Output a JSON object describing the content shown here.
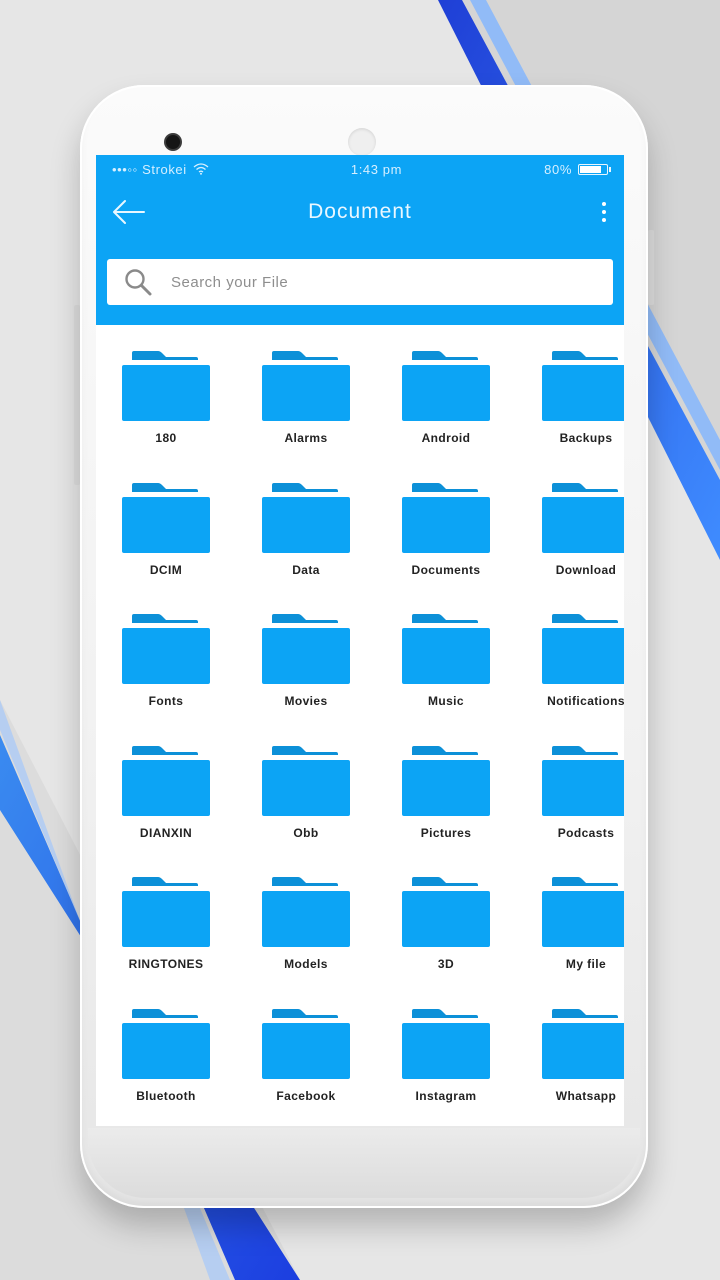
{
  "status_bar": {
    "carrier": "•••◦◦ Strokei",
    "time": "1:43 pm",
    "battery": "80%",
    "battery_level": 0.8
  },
  "app_bar": {
    "title": "Document",
    "back_icon": "arrow-left-icon",
    "menu_icon": "more-vert-icon"
  },
  "search": {
    "placeholder": "Search your File",
    "value": "",
    "icon": "search-icon"
  },
  "folders": [
    {
      "name": "180"
    },
    {
      "name": "Alarms"
    },
    {
      "name": "Android"
    },
    {
      "name": "Backups"
    },
    {
      "name": "DCIM"
    },
    {
      "name": "Data"
    },
    {
      "name": "Documents"
    },
    {
      "name": "Download"
    },
    {
      "name": "Fonts"
    },
    {
      "name": "Movies"
    },
    {
      "name": "Music"
    },
    {
      "name": "Notifications"
    },
    {
      "name": "DIANXIN"
    },
    {
      "name": "Obb"
    },
    {
      "name": "Pictures"
    },
    {
      "name": "Podcasts"
    },
    {
      "name": "RINGTONES"
    },
    {
      "name": "Models"
    },
    {
      "name": "3D"
    },
    {
      "name": "My file"
    },
    {
      "name": "Bluetooth"
    },
    {
      "name": "Facebook"
    },
    {
      "name": "Instagram"
    },
    {
      "name": "Whatsapp"
    }
  ],
  "colors": {
    "accent": "#0ca4f5",
    "folder": "#0ca4f5",
    "folder_tab": "#0c90d8"
  }
}
